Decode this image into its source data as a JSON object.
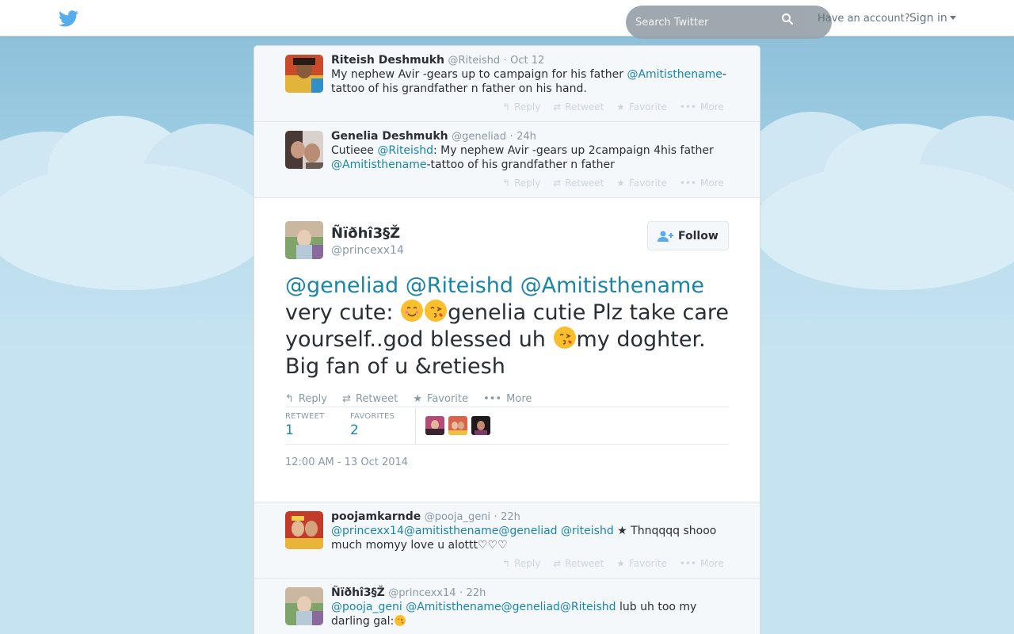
{
  "topbar": {
    "search_placeholder": "Search Twitter",
    "account_question": "Have an account?",
    "sign_in": "Sign in"
  },
  "actions": {
    "reply": "Reply",
    "retweet": "Retweet",
    "favorite": "Favorite",
    "more": "More"
  },
  "tweets_above": [
    {
      "name": "Riteish Deshmukh",
      "handle": "@Riteishd",
      "time": "Oct 12",
      "text_pre": "My nephew Avir -gears up to campaign for his father ",
      "mention1": "@Amitisthename",
      "text_post": "-tattoo of his grandfather n father on his hand."
    },
    {
      "name": "Genelia Deshmukh",
      "handle": "@geneliad",
      "time": "24h",
      "text_pre": "Cutieee ",
      "mention1": "@Riteishd",
      "text_mid": ": My nephew Avir -gears up 2campaign 4his father ",
      "mention2": "@Amitisthename",
      "text_post": "-tattoo of his grandfather n father"
    }
  ],
  "main_tweet": {
    "name": "Ñïðhî3§Ž",
    "handle": "@princexx14",
    "follow_label": "Follow",
    "mentions": [
      "@geneliad",
      "@Riteishd",
      "@Amitisthename"
    ],
    "text_a": "very cute: ",
    "text_b": "genelia cutie Plz  take care yourself..god blessed uh ",
    "text_c": "my doghter. Big fan of u &retiesh",
    "retweet_label": "RETWEET",
    "retweet_count": "1",
    "favorites_label": "FAVORITES",
    "favorites_count": "2",
    "date": "12:00 AM - 13 Oct 2014"
  },
  "replies": [
    {
      "name": "poojamkarnde",
      "handle": "@pooja_geni",
      "time": "22h",
      "mentions": [
        "@princexx14",
        "@amitisthename",
        "@geneliad",
        "@riteishd"
      ],
      "text_post": " ★ Thnqqqq shooo much momyy love u alottt♡♡♡"
    },
    {
      "name": "Ñïðhî3§Ž",
      "handle": "@princexx14",
      "time": "22h",
      "mentions": [
        "@pooja_geni",
        "@Amitisthename",
        "@geneliad",
        "@Riteishd"
      ],
      "text_post": " lub uh too my darling gal:"
    }
  ],
  "colors": {
    "link": "#1b85a8",
    "brand": "#55acee",
    "muted": "#8899a6"
  }
}
